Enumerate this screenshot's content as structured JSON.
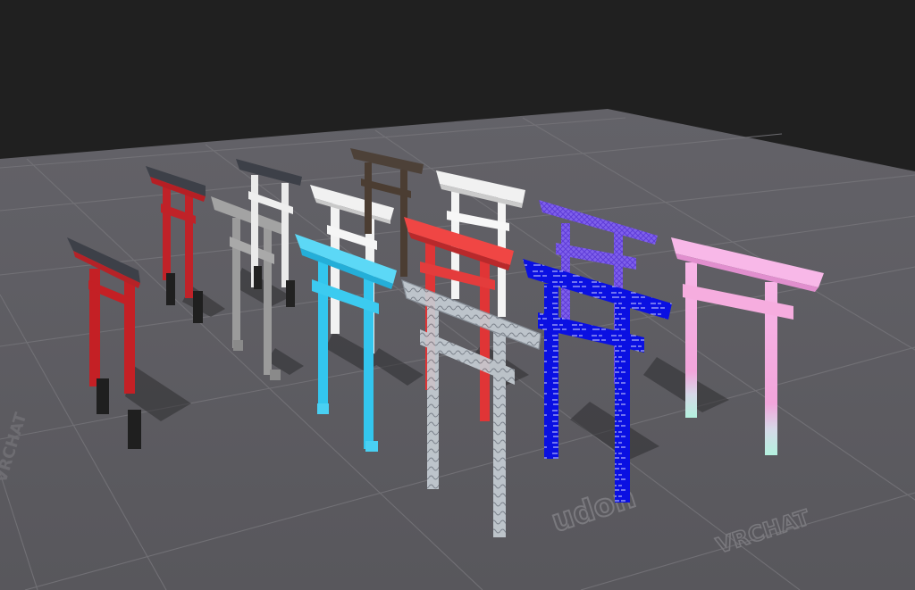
{
  "scene": {
    "background_color": "#202020",
    "floor_color": "#5e5d62",
    "grid_line_color": "#747378",
    "watermarks": [
      "VRCHAT",
      "udon",
      "VRCHAT"
    ]
  },
  "gates": [
    {
      "id": "red-1",
      "pillar": "#c42025",
      "base": "#1f1f1f",
      "top": "#3d4048"
    },
    {
      "id": "red-2",
      "pillar": "#c02228",
      "base": "#1f1f1f",
      "top": "#3d4048"
    },
    {
      "id": "gray-1",
      "pillar": "#9b9b9b",
      "base": "#8a8a8a",
      "top": "#9b9b9b"
    },
    {
      "id": "white-black-top",
      "pillar": "#eaeaea",
      "base": "#222222",
      "top": "#3d4048"
    },
    {
      "id": "white-2",
      "pillar": "#f2f2f2",
      "base": "#f2f2f2",
      "top": "#f2f2f2"
    },
    {
      "id": "brown",
      "pillar": "#4b3d32",
      "base": "#2a241f",
      "top": "#4b3d32"
    },
    {
      "id": "white-3",
      "pillar": "#f4f4f4",
      "base": "#f4f4f4",
      "top": "#f4f4f4"
    },
    {
      "id": "cyan",
      "pillar": "#33c6ee",
      "base": "#33c6ee",
      "top": "#5cd8f6"
    },
    {
      "id": "red-3",
      "pillar": "#e03536",
      "base": "#e03536",
      "top": "#f04644"
    },
    {
      "id": "glass",
      "pillar": "#aeb6bf",
      "base": "#aeb6bf",
      "top": "#c2c9d1"
    },
    {
      "id": "violet-wire",
      "pillar": "#7e55e8",
      "base": "#7e55e8",
      "top": "#7a5ff0"
    },
    {
      "id": "blue-text",
      "pillar": "#0a0ee2",
      "base": "#0a0ee2",
      "top": "#0a14d8"
    },
    {
      "id": "pink-gradient",
      "pillar": "#f3a7dd",
      "base": "#bdf2e5",
      "top": "#f8b8e8"
    }
  ]
}
